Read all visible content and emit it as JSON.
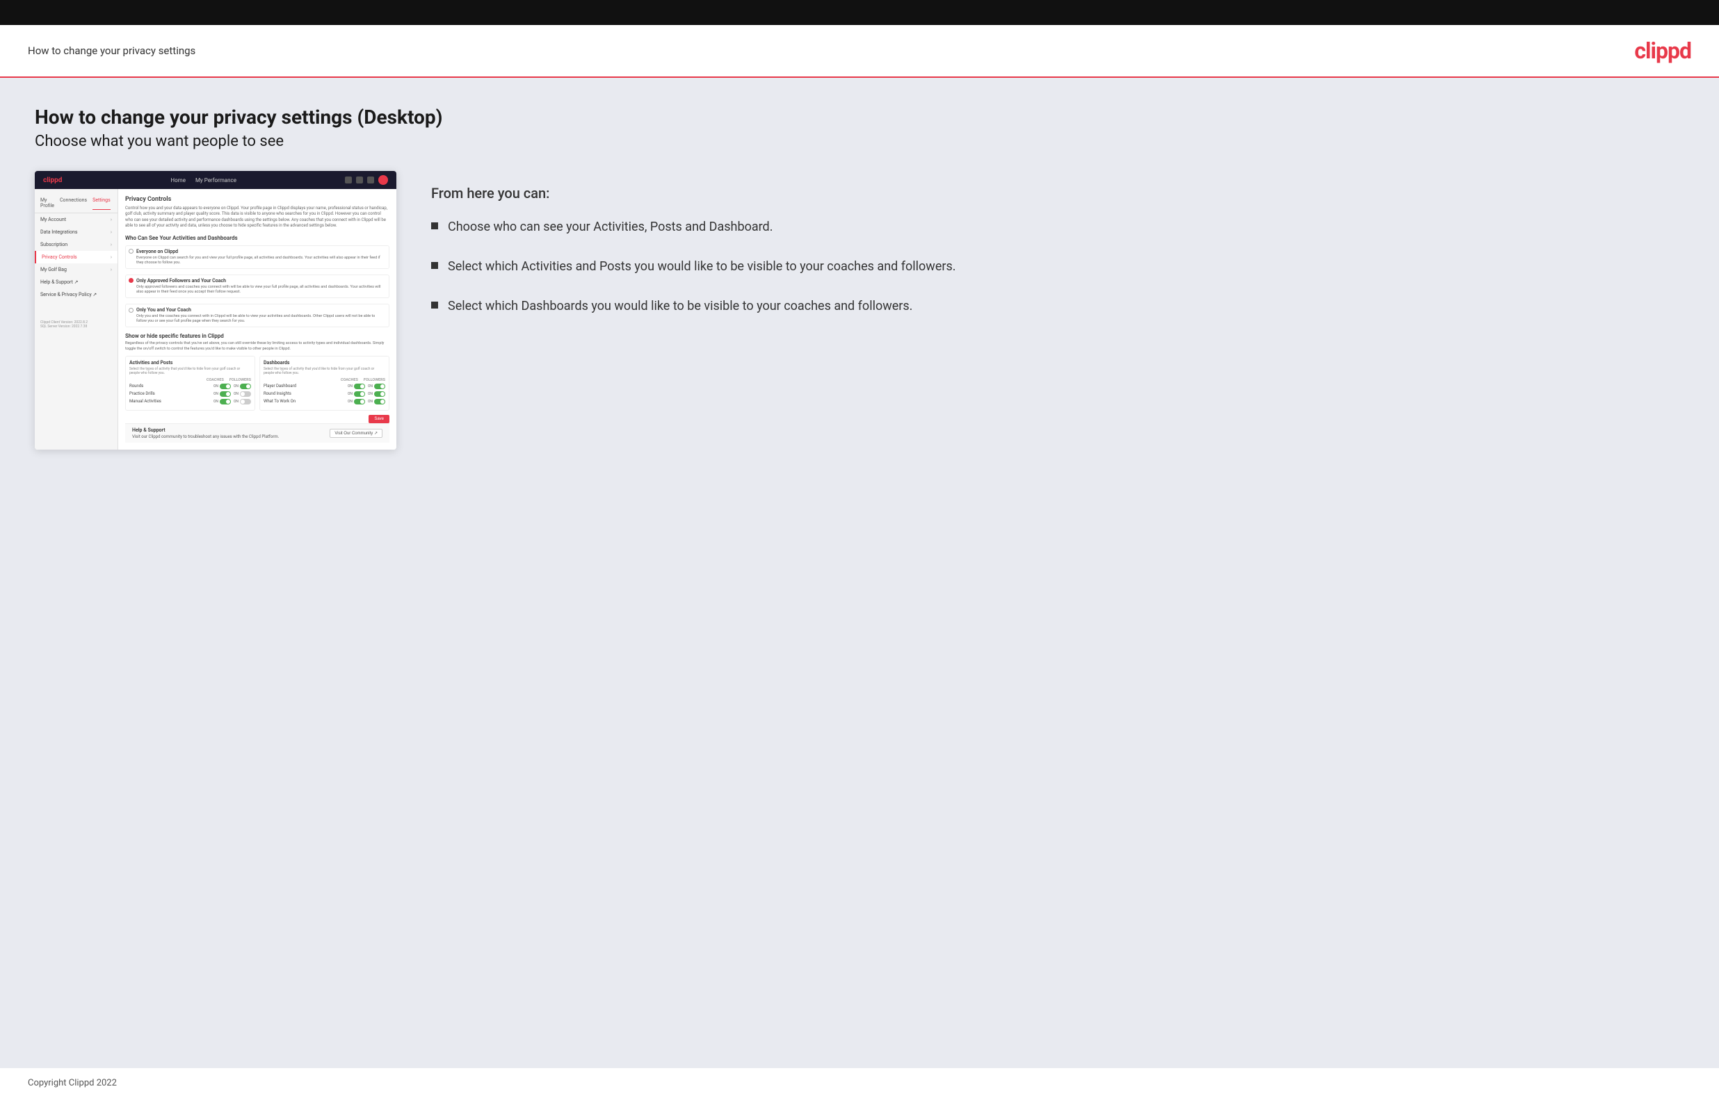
{
  "header": {
    "title": "How to change your privacy settings",
    "logo": "clippd"
  },
  "page": {
    "heading": "How to change your privacy settings (Desktop)",
    "subheading": "Choose what you want people to see"
  },
  "from_here": {
    "title": "From here you can:",
    "bullets": [
      "Choose who can see your Activities, Posts and Dashboard.",
      "Select which Activities and Posts you would like to be visible to your coaches and followers.",
      "Select which Dashboards you would like to be visible to your coaches and followers."
    ]
  },
  "mockup": {
    "nav": [
      "Home",
      "My Performance"
    ],
    "sidebar_tabs": [
      "My Profile",
      "Connections",
      "Settings"
    ],
    "sidebar_items": [
      {
        "label": "My Account",
        "active": false
      },
      {
        "label": "Data Integrations",
        "active": false
      },
      {
        "label": "Subscription",
        "active": false
      },
      {
        "label": "Privacy Controls",
        "active": true
      },
      {
        "label": "My Golf Bag",
        "active": false
      },
      {
        "label": "Help & Support",
        "active": false
      },
      {
        "label": "Service & Privacy Policy",
        "active": false
      }
    ],
    "version": "Clippd Client Version: 2022.8.2\nSQL Server Version: 2022.7.38",
    "section_title": "Privacy Controls",
    "section_desc": "Control how you and your data appears to everyone on Clippd. Your profile page in Clippd displays your name, professional status or handicap, golf club, activity summary and player quality score. This data is visible to anyone who searches for you in Clippd. However you can control who can see your detailed activity and performance dashboards using the settings below. Any coaches that you connect with in Clippd will be able to see all of your activity and data, unless you choose to hide specific features in the advanced settings below.",
    "who_title": "Who Can See Your Activities and Dashboards",
    "radio_options": [
      {
        "label": "Everyone on Clippd",
        "desc": "Everyone on Clippd can search for you and view your full profile page, all activities and dashboards. Your activities will also appear in their feed if they choose to follow you.",
        "selected": false
      },
      {
        "label": "Only Approved Followers and Your Coach",
        "desc": "Only approved followers and coaches you connect with will be able to view your full profile page, all activities and dashboards. Your activities will also appear in their feed once you accept their follow request.",
        "selected": true
      },
      {
        "label": "Only You and Your Coach",
        "desc": "Only you and the coaches you connect with in Clippd will be able to view your activities and dashboards. Other Clippd users will not be able to follow you or see your full profile page when they search for you.",
        "selected": false
      }
    ],
    "showhide_title": "Show or hide specific features in Clippd",
    "showhide_desc": "Regardless of the privacy controls that you've set above, you can still override these by limiting access to activity types and individual dashboards. Simply toggle the on/off switch to control the features you'd like to make visible to other people in Clippd.",
    "activities_panel": {
      "title": "Activities and Posts",
      "desc": "Select the types of activity that you'd like to hide from your golf coach or people who follow you.",
      "columns": [
        "COACHES",
        "FOLLOWERS"
      ],
      "rows": [
        {
          "name": "Rounds",
          "coaches": true,
          "followers": true
        },
        {
          "name": "Practice Drills",
          "coaches": true,
          "followers": false
        },
        {
          "name": "Manual Activities",
          "coaches": true,
          "followers": false
        }
      ]
    },
    "dashboards_panel": {
      "title": "Dashboards",
      "desc": "Select the types of activity that you'd like to hide from your golf coach or people who follow you.",
      "columns": [
        "COACHES",
        "FOLLOWERS"
      ],
      "rows": [
        {
          "name": "Player Dashboard",
          "coaches": true,
          "followers": true
        },
        {
          "name": "Round Insights",
          "coaches": true,
          "followers": true
        },
        {
          "name": "What To Work On",
          "coaches": true,
          "followers": true
        }
      ]
    },
    "save_label": "Save",
    "help": {
      "title": "Help & Support",
      "desc": "Visit our Clippd community to troubleshoot any issues with the Clippd Platform.",
      "button": "Visit Our Community"
    }
  },
  "footer": {
    "copyright": "Copyright Clippd 2022"
  }
}
